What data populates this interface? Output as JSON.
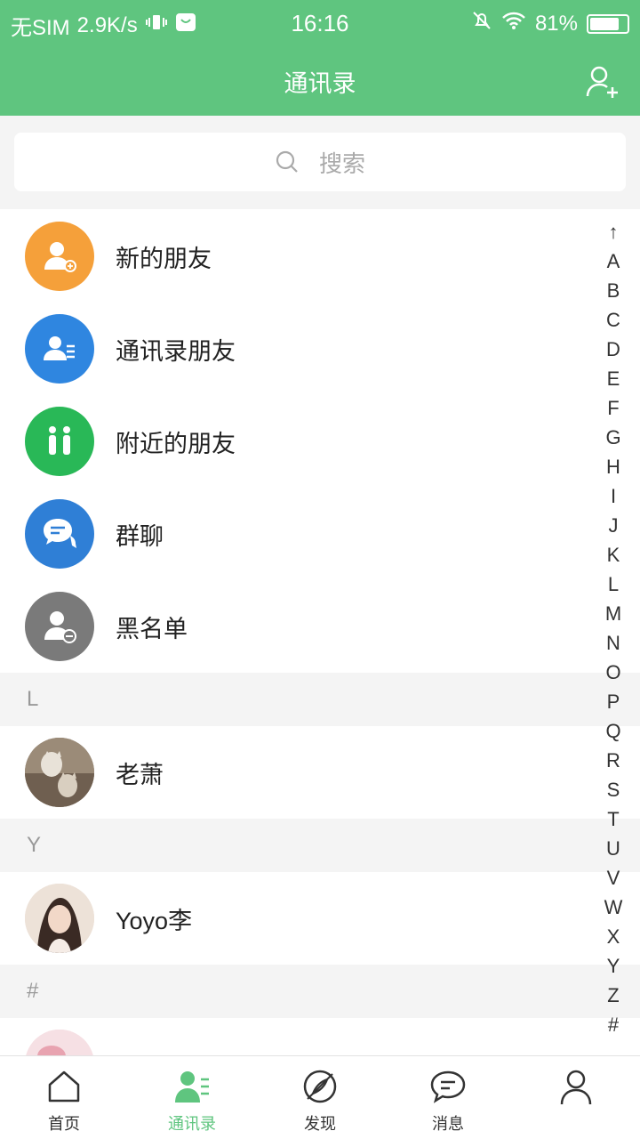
{
  "status_bar": {
    "carrier": "无SIM",
    "speed": "2.9K/s",
    "time": "16:16",
    "battery": "81%",
    "battery_level": 0.81
  },
  "header": {
    "title": "通讯录"
  },
  "search": {
    "placeholder": "搜索"
  },
  "features": [
    {
      "label": "新的朋友",
      "color": "#f5a03a",
      "icon": "new-friend-icon"
    },
    {
      "label": "通讯录朋友",
      "color": "#2f86e0",
      "icon": "address-book-friend-icon"
    },
    {
      "label": "附近的朋友",
      "color": "#29b857",
      "icon": "nearby-icon"
    },
    {
      "label": "群聊",
      "color": "#2f7fd6",
      "icon": "group-chat-icon"
    },
    {
      "label": "黑名单",
      "color": "#7a7a7a",
      "icon": "blacklist-icon"
    }
  ],
  "sections": [
    {
      "letter": "L",
      "contacts": [
        {
          "name": "老萧"
        }
      ]
    },
    {
      "letter": "Y",
      "contacts": [
        {
          "name": "Yoyo李"
        }
      ]
    },
    {
      "letter": "#",
      "contacts": []
    }
  ],
  "index_letters": [
    "↑",
    "A",
    "B",
    "C",
    "D",
    "E",
    "F",
    "G",
    "H",
    "I",
    "J",
    "K",
    "L",
    "M",
    "N",
    "O",
    "P",
    "Q",
    "R",
    "S",
    "T",
    "U",
    "V",
    "W",
    "X",
    "Y",
    "Z",
    "#"
  ],
  "tabs": [
    {
      "label": "首页",
      "icon": "home-icon",
      "active": false
    },
    {
      "label": "通讯录",
      "icon": "contacts-icon",
      "active": true
    },
    {
      "label": "发现",
      "icon": "discover-icon",
      "active": false
    },
    {
      "label": "消息",
      "icon": "message-icon",
      "active": false
    },
    {
      "label": "",
      "icon": "profile-icon",
      "active": false
    }
  ],
  "colors": {
    "accent": "#5fc57f",
    "background": "#f4f4f4"
  }
}
